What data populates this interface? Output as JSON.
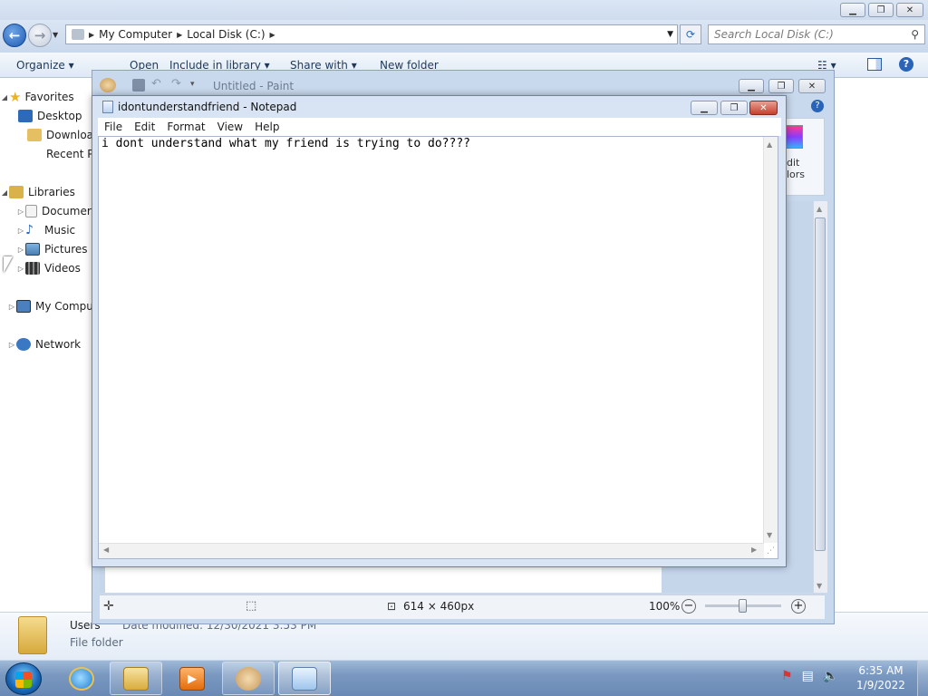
{
  "explorer": {
    "address": {
      "crumbs": [
        "My Computer",
        "Local Disk (C:)"
      ]
    },
    "search_placeholder": "Search Local Disk (C:)",
    "toolbar": {
      "organize": "Organize",
      "open": "Open",
      "include_in_library": "Include in library",
      "share_with": "Share with",
      "new_folder": "New folder"
    },
    "nav": {
      "favorites": "Favorites",
      "desktop": "Desktop",
      "downloads": "Downloa",
      "recent": "Recent Pl",
      "libraries": "Libraries",
      "documents": "Documer",
      "music": "Music",
      "pictures": "Pictures",
      "videos": "Videos",
      "computer": "My Compu",
      "network": "Network"
    },
    "details": {
      "name": "Users",
      "modified": "Date modified: 12/30/2021 3:53 PM",
      "type": "File folder"
    }
  },
  "paint": {
    "title": "Untitled - Paint",
    "ribbon_partial": [
      "dit",
      "lors"
    ],
    "status": {
      "dimensions": "614 × 460px",
      "zoom": "100%"
    }
  },
  "notepad": {
    "title": "idontunderstandfriend - Notepad",
    "menu": [
      "File",
      "Edit",
      "Format",
      "View",
      "Help"
    ],
    "content": "i dont understand what my friend is trying to do????"
  },
  "taskbar": {
    "time": "6:35 AM",
    "date": "1/9/2022",
    "apps": [
      "internet-explorer",
      "windows-explorer",
      "media-player",
      "paint",
      "notepad"
    ]
  },
  "colors": {
    "accent": "#1f5ab4",
    "taskbar": "#7a98c0",
    "window_frame": "#d8e4f3"
  }
}
